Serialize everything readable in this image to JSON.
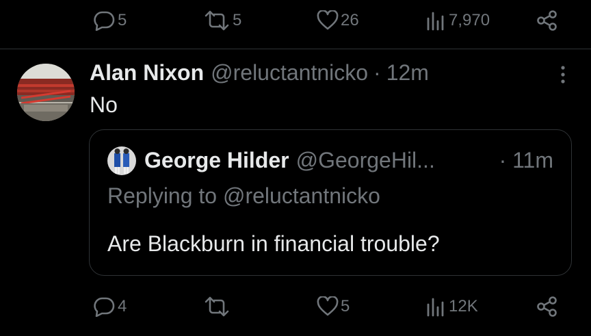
{
  "top_actions": {
    "replies": "5",
    "reposts": "5",
    "likes": "26",
    "views": "7,970"
  },
  "tweet": {
    "display_name": "Alan Nixon",
    "handle": "@reluctantnicko",
    "separator": "·",
    "time": "12m",
    "text": "No",
    "quote": {
      "display_name": "George Hilder",
      "handle": "@GeorgeHil...",
      "time": "· 11m",
      "replying_prefix": "Replying to",
      "replying_handle": "@reluctantnicko",
      "text": "Are Blackburn in financial trouble?"
    }
  },
  "bottom_actions": {
    "replies": "4",
    "reposts": "",
    "likes": "5",
    "views": "12K"
  },
  "colors": {
    "background": "#000000",
    "primary_text": "#e7e9ea",
    "secondary_text": "#71767b",
    "border": "#2f3336"
  },
  "icons": [
    "reply-icon",
    "repost-icon",
    "like-icon",
    "views-icon",
    "share-icon",
    "more-options-icon"
  ]
}
